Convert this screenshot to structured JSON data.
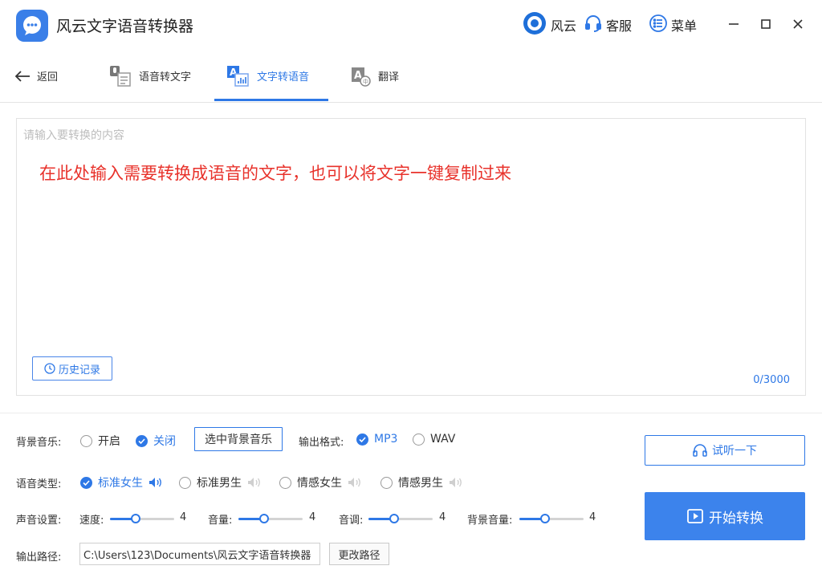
{
  "app": {
    "title": "风云文字语音转换器",
    "accent_color": "#2e78e6",
    "hint_color": "#e8322b"
  },
  "topbar": {
    "brand_label": "风云",
    "service_label": "客服",
    "menu_label": "菜单"
  },
  "nav": {
    "back_label": "返回",
    "tabs": [
      {
        "label": "语音转文字",
        "icon": "speech-to-text-icon",
        "active": false
      },
      {
        "label": "文字转语音",
        "icon": "text-to-speech-icon",
        "active": true
      },
      {
        "label": "翻译",
        "icon": "translate-icon",
        "active": false
      }
    ]
  },
  "editor": {
    "placeholder": "请输入要转换的内容",
    "value": "",
    "hint": "在此处输入需要转换成语音的文字，也可以将文字一键复制过来",
    "history_label": "历史记录",
    "char_count": "0/3000"
  },
  "settings": {
    "bgm": {
      "label": "背景音乐:",
      "options": [
        "开启",
        "关闭"
      ],
      "selected": "关闭",
      "select_button": "选中背景音乐"
    },
    "format": {
      "label": "输出格式:",
      "options": [
        "MP3",
        "WAV"
      ],
      "selected": "MP3"
    },
    "voice": {
      "label": "语音类型:",
      "options": [
        "标准女生",
        "标准男生",
        "情感女生",
        "情感男生"
      ],
      "selected": "标准女生"
    },
    "sound": {
      "label": "声音设置:",
      "sliders": [
        {
          "label": "速度:",
          "value": "4",
          "level": 0.4
        },
        {
          "label": "音量:",
          "value": "4",
          "level": 0.4
        },
        {
          "label": "音调:",
          "value": "4",
          "level": 0.4
        },
        {
          "label": "背景音量:",
          "value": "4",
          "level": 0.4
        }
      ]
    },
    "output": {
      "label": "输出路径:",
      "path": "C:\\Users\\123\\Documents\\风云文字语音转换器",
      "change_button": "更改路径"
    }
  },
  "actions": {
    "listen_label": "试听一下",
    "start_label": "开始转换"
  }
}
